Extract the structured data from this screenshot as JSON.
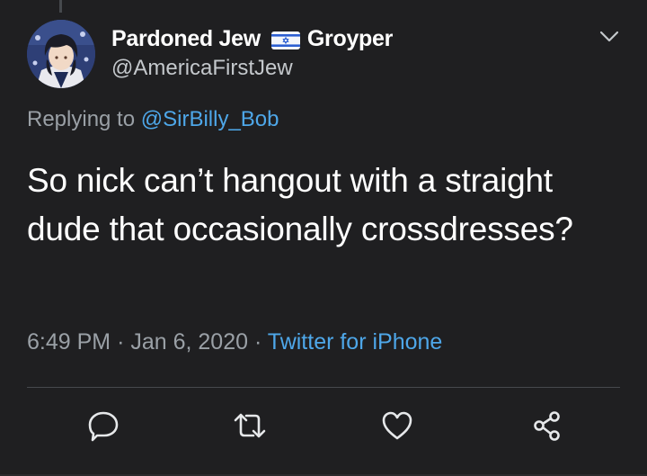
{
  "tweet": {
    "display_name": "Pardoned Jew",
    "display_name_suffix": "Groyper",
    "handle": "@AmericaFirstJew",
    "replying_to_prefix": "Replying to",
    "replying_to_handle": "@SirBilly_Bob",
    "text": "So nick can’t hangout with a straight dude that occasionally crossdresses?",
    "time": "6:49 PM",
    "separator": "·",
    "date": "Jan 6, 2020",
    "source": "Twitter for iPhone"
  },
  "icons": {
    "flag": "israel-flag-icon",
    "menu": "chevron-down-icon",
    "reply": "reply-icon",
    "retweet": "retweet-icon",
    "like": "heart-icon",
    "share": "share-icon"
  },
  "colors": {
    "background": "#1f1f21",
    "link": "#4ea7e9",
    "secondary_text": "#9aa0a6",
    "icon": "#e6e8ea"
  }
}
